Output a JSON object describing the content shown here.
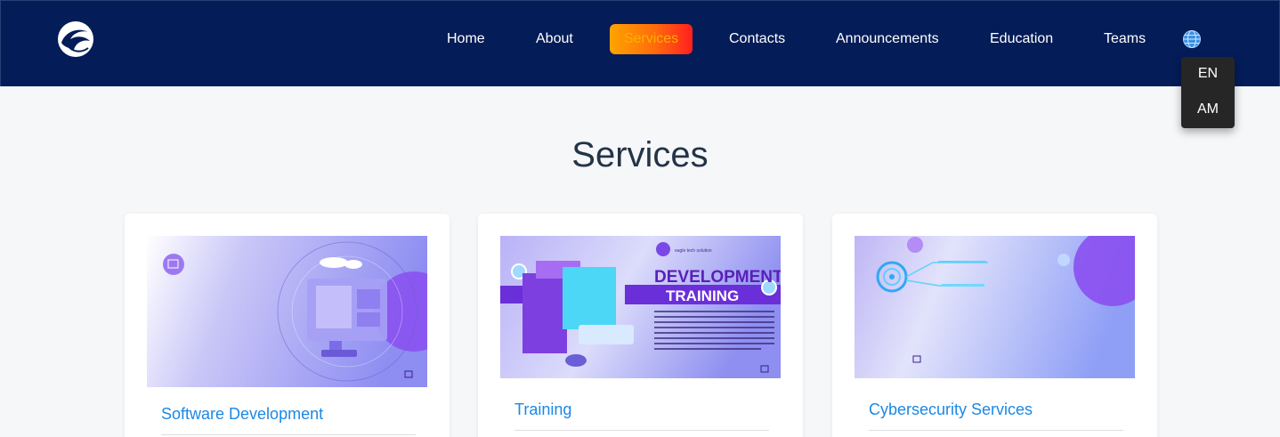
{
  "nav": {
    "items": [
      {
        "label": "Home"
      },
      {
        "label": "About"
      },
      {
        "label": "Services"
      },
      {
        "label": "Contacts"
      },
      {
        "label": "Announcements"
      },
      {
        "label": "Education"
      },
      {
        "label": "Teams"
      }
    ],
    "active_item": "Services",
    "active_gradient": [
      "#ffa400",
      "#ff1f1f"
    ],
    "language_menu": {
      "icon": "globe-icon",
      "options": [
        "EN",
        "AM"
      ]
    }
  },
  "page": {
    "title": "Services"
  },
  "cards": [
    {
      "title": "Software Development",
      "image_icon": "monitor-illustration"
    },
    {
      "title": "Training",
      "image_icon": "computer-illustration",
      "image_text": {
        "brand": "eagle tech solution",
        "heading": "DEVELOPMENT",
        "subheading": "TRAINING"
      }
    },
    {
      "title": "Cybersecurity Services",
      "image_icon": "circuit-illustration"
    }
  ],
  "colors": {
    "navbar": "#041c57",
    "card_title": "#1b88e6",
    "heading": "#243447"
  }
}
